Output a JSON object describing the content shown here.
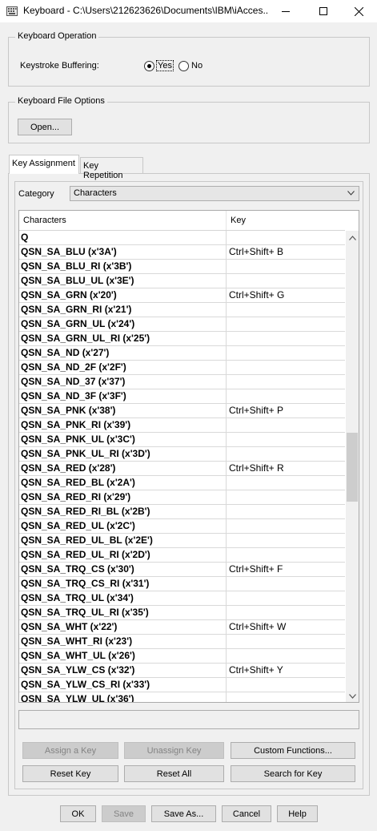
{
  "window": {
    "title": "Keyboard - C:\\Users\\212623626\\Documents\\IBM\\iAcces...",
    "icon": "keyboard-icon"
  },
  "keyboard_operation": {
    "legend": "Keyboard Operation",
    "label": "Keystroke Buffering:",
    "yes_label": "Yes",
    "no_label": "No",
    "selected": "Yes"
  },
  "keyboard_file": {
    "legend": "Keyboard File Options",
    "open_label": "Open..."
  },
  "tabs": [
    {
      "label": "Key Assignment",
      "active": true
    },
    {
      "label": "Key Repetition",
      "active": false
    }
  ],
  "category": {
    "label": "Category",
    "value": "Characters"
  },
  "table": {
    "columns": [
      "Characters",
      "Key"
    ],
    "rows": [
      {
        "name": "Q",
        "key": ""
      },
      {
        "name": "QSN_SA_BLU (x'3A')",
        "key": "Ctrl+Shift+ B"
      },
      {
        "name": "QSN_SA_BLU_RI (x'3B')",
        "key": ""
      },
      {
        "name": "QSN_SA_BLU_UL (x'3E')",
        "key": ""
      },
      {
        "name": "QSN_SA_GRN (x'20')",
        "key": "Ctrl+Shift+ G"
      },
      {
        "name": "QSN_SA_GRN_RI (x'21')",
        "key": ""
      },
      {
        "name": "QSN_SA_GRN_UL (x'24')",
        "key": ""
      },
      {
        "name": "QSN_SA_GRN_UL_RI (x'25')",
        "key": ""
      },
      {
        "name": "QSN_SA_ND (x'27')",
        "key": ""
      },
      {
        "name": "QSN_SA_ND_2F (x'2F')",
        "key": ""
      },
      {
        "name": "QSN_SA_ND_37 (x'37')",
        "key": ""
      },
      {
        "name": "QSN_SA_ND_3F (x'3F')",
        "key": ""
      },
      {
        "name": "QSN_SA_PNK (x'38')",
        "key": "Ctrl+Shift+ P"
      },
      {
        "name": "QSN_SA_PNK_RI (x'39')",
        "key": ""
      },
      {
        "name": "QSN_SA_PNK_UL (x'3C')",
        "key": ""
      },
      {
        "name": "QSN_SA_PNK_UL_RI (x'3D')",
        "key": ""
      },
      {
        "name": "QSN_SA_RED (x'28')",
        "key": "Ctrl+Shift+ R"
      },
      {
        "name": "QSN_SA_RED_BL (x'2A')",
        "key": ""
      },
      {
        "name": "QSN_SA_RED_RI (x'29')",
        "key": ""
      },
      {
        "name": "QSN_SA_RED_RI_BL (x'2B')",
        "key": ""
      },
      {
        "name": "QSN_SA_RED_UL (x'2C')",
        "key": ""
      },
      {
        "name": "QSN_SA_RED_UL_BL (x'2E')",
        "key": ""
      },
      {
        "name": "QSN_SA_RED_UL_RI (x'2D')",
        "key": ""
      },
      {
        "name": "QSN_SA_TRQ_CS (x'30')",
        "key": "Ctrl+Shift+ F"
      },
      {
        "name": "QSN_SA_TRQ_CS_RI (x'31')",
        "key": ""
      },
      {
        "name": "QSN_SA_TRQ_UL (x'34')",
        "key": ""
      },
      {
        "name": "QSN_SA_TRQ_UL_RI (x'35')",
        "key": ""
      },
      {
        "name": "QSN_SA_WHT (x'22')",
        "key": "Ctrl+Shift+ W"
      },
      {
        "name": "QSN_SA_WHT_RI (x'23')",
        "key": ""
      },
      {
        "name": "QSN_SA_WHT_UL (x'26')",
        "key": ""
      },
      {
        "name": "QSN_SA_YLW_CS (x'32')",
        "key": "Ctrl+Shift+ Y"
      },
      {
        "name": "QSN_SA_YLW_CS_RI (x'33')",
        "key": ""
      },
      {
        "name": "QSN_SA_YLW_UL (x'36')",
        "key": ""
      }
    ]
  },
  "status_text": "",
  "actions": {
    "assign": "Assign a Key",
    "unassign": "Unassign Key",
    "custom": "Custom Functions...",
    "reset_key": "Reset Key",
    "reset_all": "Reset All",
    "search": "Search for Key"
  },
  "footer": {
    "ok": "OK",
    "save": "Save",
    "save_as": "Save As...",
    "cancel": "Cancel",
    "help": "Help"
  }
}
